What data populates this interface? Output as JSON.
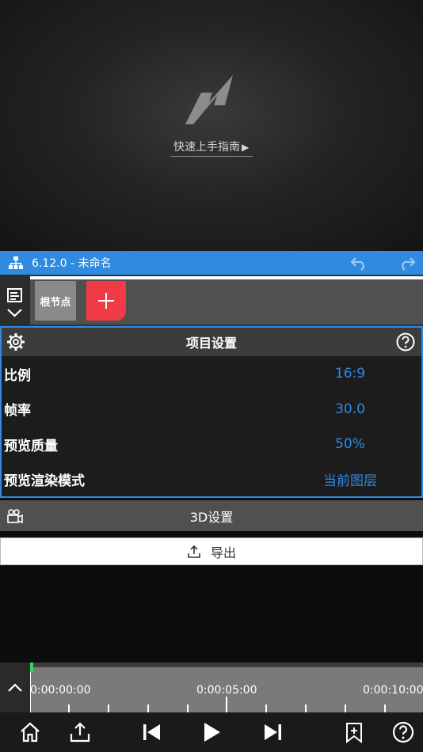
{
  "preview": {
    "guide_label": "快速上手指南",
    "guide_arrow": "▶"
  },
  "titlebar": {
    "title": "6.12.0 - 未命名",
    "icons": [
      "hierarchy-icon",
      "undo-icon",
      "redo-icon"
    ]
  },
  "nodes": {
    "root_label": "根节点",
    "add_icon": "plus-icon",
    "menu_icon": "list-collapse-icon"
  },
  "project_settings": {
    "title": "项目设置",
    "rows": [
      {
        "label": "比例",
        "value": "16:9"
      },
      {
        "label": "帧率",
        "value": "30.0"
      },
      {
        "label": "预览质量",
        "value": "50%"
      },
      {
        "label": "预览渲染模式",
        "value": "当前图层"
      }
    ]
  },
  "settings_3d": {
    "label": "3D设置"
  },
  "export": {
    "label": "导出"
  },
  "timeline": {
    "time_labels": [
      "0:00:00:00",
      "0:00:05:00",
      "0:00:10:00"
    ]
  },
  "colors": {
    "accent": "#2f8ae0",
    "add_button": "#f03a45",
    "playhead": "#38d26a"
  }
}
